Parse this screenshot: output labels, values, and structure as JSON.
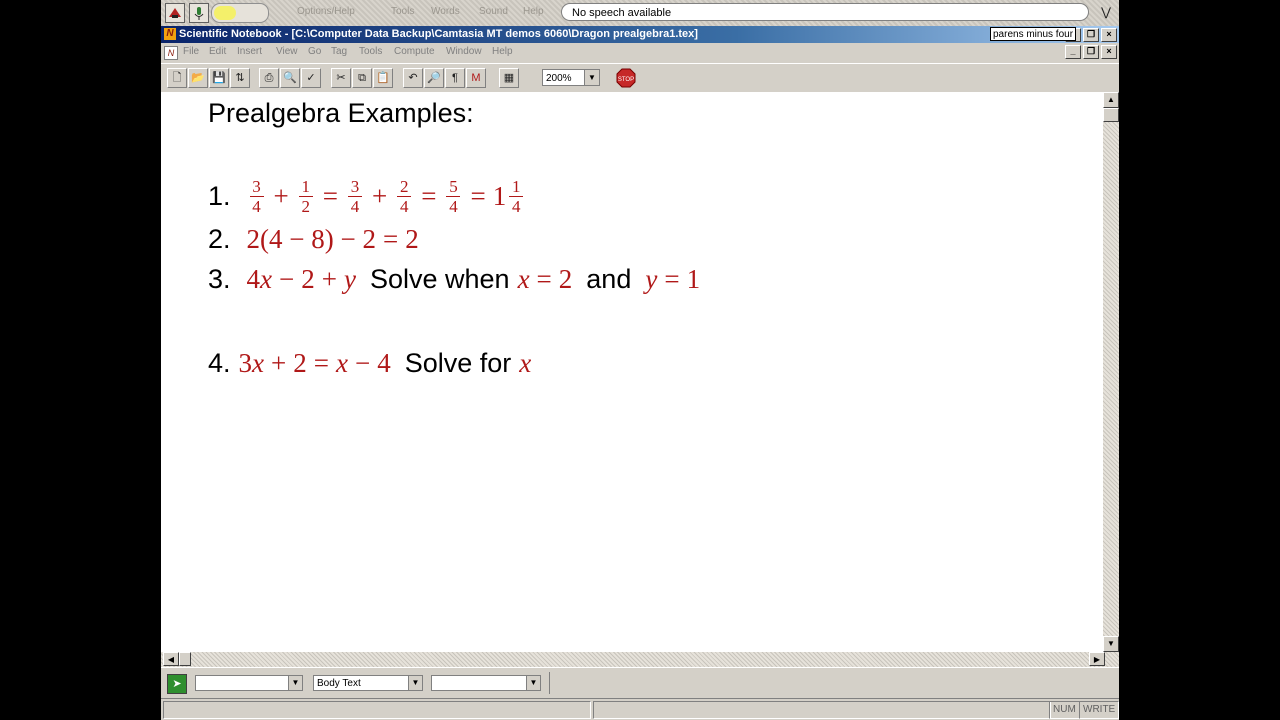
{
  "speech_bar": {
    "faded_menu": [
      "Options/Help",
      "Tools",
      "Words",
      "Sound",
      "Help"
    ],
    "status": "No speech available"
  },
  "window": {
    "title": "Scientific Notebook - [C:\\Computer Data Backup\\Camtasia MT demos 6060\\Dragon prealgebra1.tex]",
    "recognized_hint": "parens minus four"
  },
  "menu": [
    "File",
    "Edit",
    "Insert",
    "View",
    "Go",
    "Tag",
    "Tools",
    "Compute",
    "Window",
    "Help"
  ],
  "toolbar": {
    "zoom": "200%"
  },
  "document": {
    "heading": "Prealgebra Examples:",
    "line1": {
      "num": "1.",
      "f1n": "3",
      "f1d": "4",
      "plus1": "+",
      "f2n": "1",
      "f2d": "2",
      "eq1": "=",
      "f3n": "3",
      "f3d": "4",
      "plus2": "+",
      "f4n": "2",
      "f4d": "4",
      "eq2": "=",
      "f5n": "5",
      "f5d": "4",
      "eq3": "=",
      "whole": "1",
      "f6n": "1",
      "f6d": "4"
    },
    "line2": {
      "num": "2.",
      "expr": "2(4 − 8) − 2",
      "eq": "=",
      "rhs": "2"
    },
    "line3": {
      "num": "3.",
      "c4": "4",
      "x": "x",
      "minus": "−",
      "two": "2",
      "plus": "+",
      "y": "y",
      "t1": "Solve when",
      "x2": "x",
      "eqa": "=",
      "val_x": "2",
      "t2": "and",
      "y2": "y",
      "eqb": "=",
      "val_y": "1"
    },
    "line4": {
      "num": "4.",
      "c3": "3",
      "x": "x",
      "plus": "+",
      "two": "2",
      "eq": "=",
      "x2": "x",
      "minus": "−",
      "four": "4",
      "t": "Solve for",
      "x3": "x"
    }
  },
  "bottom_toolbar": {
    "tag1": "",
    "tag2": "Body Text",
    "tag3": ""
  },
  "statusbar": {
    "num": "NUM",
    "write": "WRITE"
  }
}
